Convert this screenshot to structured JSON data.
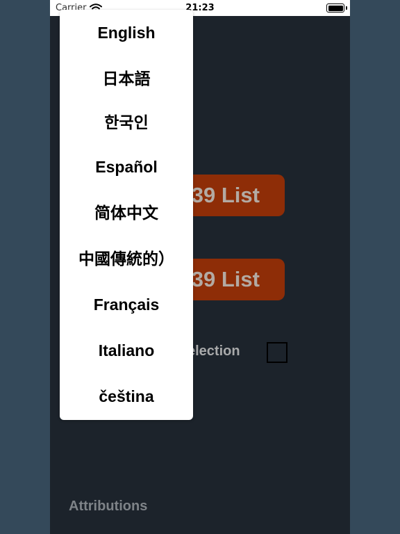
{
  "status_bar": {
    "carrier": "Carrier",
    "time": "21:23"
  },
  "main": {
    "buttons": [
      {
        "label": "39 List"
      },
      {
        "label": "39 List"
      }
    ],
    "selection_label": "election",
    "selection_checked": false,
    "attributions_label": "Attributions"
  },
  "language_menu": {
    "items": [
      {
        "label": "English"
      },
      {
        "label": "日本語"
      },
      {
        "label": "한국인"
      },
      {
        "label": "Español"
      },
      {
        "label": "简体中文"
      },
      {
        "label": "中國傳統的）"
      },
      {
        "label": "Français"
      },
      {
        "label": "Italiano"
      },
      {
        "label": "čeština"
      }
    ]
  },
  "colors": {
    "page_background": "#34495a",
    "app_background": "#1c232b",
    "button_background": "#8e2d07",
    "button_text": "#b3aaa3",
    "muted_text": "#a8a9aa",
    "menu_background": "#ffffff"
  },
  "icons": [
    "wifi-icon",
    "battery-icon"
  ]
}
